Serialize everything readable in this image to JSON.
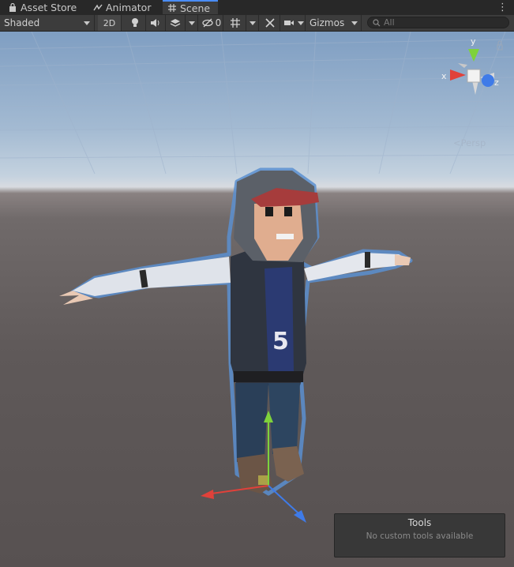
{
  "tabs": [
    {
      "label": "Asset Store",
      "icon": "shopping-bag-icon"
    },
    {
      "label": "Animator",
      "icon": "animator-icon"
    },
    {
      "label": "Scene",
      "icon": "grid-icon",
      "active": true
    }
  ],
  "toolbar": {
    "shading_mode": "Shaded",
    "mode_2d": "2D",
    "hidden_count": "0",
    "gizmos": "Gizmos",
    "search_placeholder": "All"
  },
  "orientation_gizmo": {
    "y_label": "y",
    "x_label": "x",
    "z_label": "z",
    "projection": "Persp"
  },
  "character": {
    "shirt_number": "5"
  },
  "tools_overlay": {
    "title": "Tools",
    "message": "No custom tools available"
  },
  "colors": {
    "x_axis": "#e0413a",
    "y_axis": "#7ed23b",
    "z_axis": "#3f7be8",
    "selection_outline": "#5a8fd0",
    "active_tab_accent": "#4a8df7"
  }
}
